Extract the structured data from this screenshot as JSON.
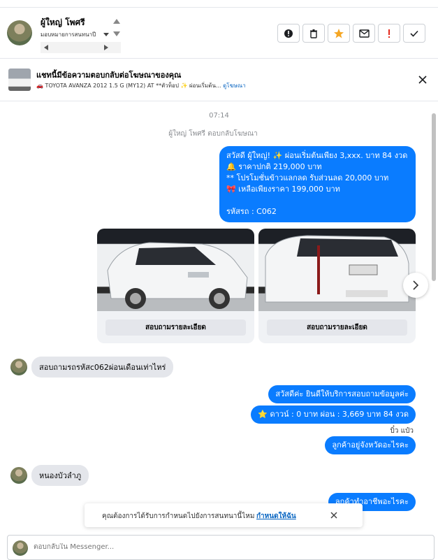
{
  "header": {
    "contact_name": "ผู้ใหญ่ โพศรี",
    "assign_label": "มอบหมายการสนทนาปี",
    "actions": [
      "!",
      "delete",
      "star",
      "mail",
      "!",
      "check"
    ]
  },
  "ad": {
    "title": "แชทนี้มีข้อความตอบกลับต่อโฆษณาของคุณ",
    "subtitle": "🚗 TOYOTA AVANZA 2012 1.5 G (MY12) AT **ตัวท็อป ✨ ผ่อนเริ่มต้น...",
    "link": "ดูโฆษณา"
  },
  "chat": {
    "time": "07:14",
    "replied_note": "ผู้ใหญ่ โพศรี ตอบกลับโฆษณา",
    "main_message": [
      "สวัสดี ผู้ใหญ่! ✨  ผ่อนเริ่มต้นเพียง 3,xxx. บาท 84 งวด",
      "🔔 ราคาปกติ 219,000 บาท",
      "** โปรโมชั่นข้าวแลกลด รับส่วนลด 20,000 บาท",
      "🎀  เหลือเพียงราคา 199,000 บาท",
      "",
      "รหัสรถ : C062"
    ],
    "cards": [
      {
        "button": "สอบถามรายละเอียด"
      },
      {
        "button": "สอบถามรายละเอียด"
      }
    ],
    "in_msg_1": "สอบถามรถรหัสc062ผ่อนเดือนเท่าไหร่",
    "out_msg_1": "สวัสดีค่ะ  ยินดีให้บริการสอบถามข้อมูลค่ะ",
    "out_msg_2": "⭐ ดาวน์ : 0 บาท ผ่อน : 3,669 บาท 84 งวด",
    "seen": "บิ๋ว แป๋ว",
    "out_msg_3": "ลูกค้าอยู่จังหวัดอะไรคะ",
    "in_msg_2": "หนองบัวลำภู",
    "out_msg_4": "ลูกค้าทำอาชีพอะไรคะ"
  },
  "notice": {
    "text": "คุณต้องการได้รับการกำหนดไปยังการสนทนานี้ไหม",
    "link": "กำหนดให้ฉัน"
  },
  "composer": {
    "placeholder": "ตอบกลับใน Messenger..."
  }
}
